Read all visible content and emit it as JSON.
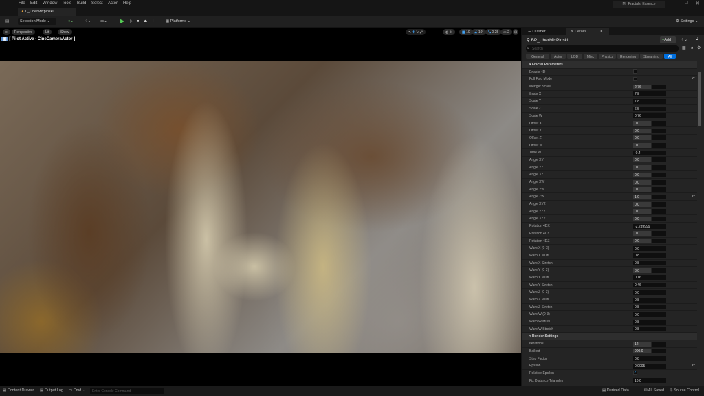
{
  "menu": [
    "File",
    "Edit",
    "Window",
    "Tools",
    "Build",
    "Select",
    "Actor",
    "Help"
  ],
  "level_tab": "L_UberMixpinski",
  "project_name": "MI_Fractals_Essence",
  "toolbar": {
    "selection_mode": "Selection Mode",
    "platforms": "Platforms",
    "settings": "Settings"
  },
  "viewport": {
    "perspective": "Perspective",
    "lit": "Lit",
    "show": "Show",
    "pilot": "[ Pilot Active - CineCameraActor ]",
    "grid": "10",
    "angle": "10°",
    "scale": "0.25",
    "camera_speed": "2"
  },
  "panel": {
    "tab_outliner": "Outliner",
    "tab_details": "Details",
    "actor_name": "BP_UberMixPinski",
    "add": "Add",
    "search_placeholder": "Search",
    "categories": [
      "General",
      "Actor",
      "LOD",
      "Misc",
      "Physics",
      "Rendering",
      "Streaming",
      "All"
    ],
    "active_category": "All"
  },
  "sections": [
    {
      "title": "Fractal Parameters",
      "rows": [
        {
          "label": "Enable 4D",
          "type": "check",
          "checked": false
        },
        {
          "label": "Full Fold Mode",
          "type": "check",
          "checked": false,
          "reset": true
        },
        {
          "label": "Menger Scale",
          "value": "2.76",
          "slider": true
        },
        {
          "label": "Scale X",
          "value": "7.8"
        },
        {
          "label": "Scale Y",
          "value": "7.8"
        },
        {
          "label": "Scale Z",
          "value": "6.5"
        },
        {
          "label": "Scale W",
          "value": "0.76"
        },
        {
          "label": "Offset X",
          "value": "0.0",
          "slider": true
        },
        {
          "label": "Offset Y",
          "value": "0.0",
          "slider": true
        },
        {
          "label": "Offset Z",
          "value": "0.0",
          "slider": true
        },
        {
          "label": "Offset W",
          "value": "0.0",
          "slider": true
        },
        {
          "label": "Time W",
          "value": "-0.4"
        },
        {
          "label": "Angle XY",
          "value": "0.0",
          "slider": true
        },
        {
          "label": "Angle YZ",
          "value": "0.0",
          "slider": true
        },
        {
          "label": "Angle XZ",
          "value": "0.0",
          "slider": true
        },
        {
          "label": "Angle XW",
          "value": "0.0",
          "slider": true
        },
        {
          "label": "Angle YW",
          "value": "0.0",
          "slider": true
        },
        {
          "label": "Angle ZW",
          "value": "1.0",
          "slider": true,
          "reset": true
        },
        {
          "label": "Angle XY2",
          "value": "0.0",
          "slider": true
        },
        {
          "label": "Angle YZ2",
          "value": "0.0",
          "slider": true
        },
        {
          "label": "Angle XZ2",
          "value": "0.0",
          "slider": true
        },
        {
          "label": "Rotation 4DX",
          "value": "-2.239999"
        },
        {
          "label": "Rotation 4DY",
          "value": "0.0",
          "slider": true
        },
        {
          "label": "Rotation 4DZ",
          "value": "0.0",
          "slider": true
        },
        {
          "label": "Warp X (0-3)",
          "value": "0.0"
        },
        {
          "label": "Warp X Multi",
          "value": "0.8"
        },
        {
          "label": "Warp X Stretch",
          "value": "0.8"
        },
        {
          "label": "Warp Y (0-3)",
          "value": "3.0",
          "slider": true
        },
        {
          "label": "Warp Y Multi",
          "value": "0.16"
        },
        {
          "label": "Warp Y Stretch",
          "value": "0.46"
        },
        {
          "label": "Warp Z (0-3)",
          "value": "0.0"
        },
        {
          "label": "Warp Z Multi",
          "value": "0.8"
        },
        {
          "label": "Warp Z Stretch",
          "value": "0.8"
        },
        {
          "label": "Warp W (0-3)",
          "value": "0.0"
        },
        {
          "label": "Warp W Multi",
          "value": "0.8"
        },
        {
          "label": "Warp W Stretch",
          "value": "0.8"
        }
      ]
    },
    {
      "title": "Render Settings",
      "rows": [
        {
          "label": "Iterations",
          "value": "12",
          "slider": true
        },
        {
          "label": "Bailout",
          "value": "900.0",
          "slider": true
        },
        {
          "label": "Step Factor",
          "value": "0.8"
        },
        {
          "label": "Epsilon",
          "value": "0.0005",
          "reset": true
        },
        {
          "label": "Relative Epsilon",
          "type": "check",
          "checked": true
        },
        {
          "label": "Fix Distance Triangles",
          "value": "10.0"
        }
      ]
    }
  ],
  "status": {
    "content_drawer": "Content Drawer",
    "output_log": "Output Log",
    "cmd": "Cmd",
    "console_placeholder": "Enter Console Command",
    "derived_data": "Derived Data",
    "all_saved": "All Saved",
    "source_control": "Source Control"
  }
}
